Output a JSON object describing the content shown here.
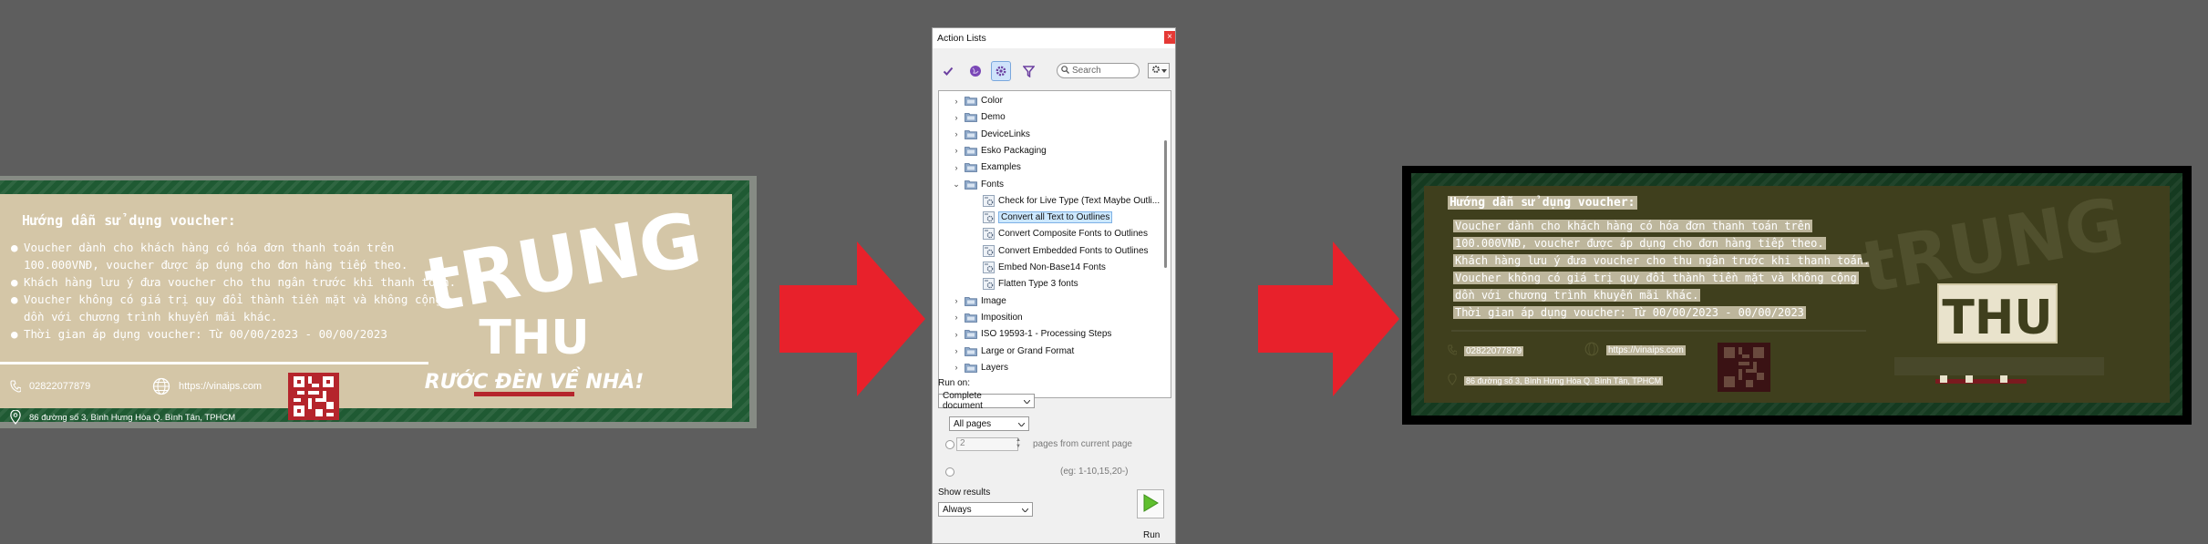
{
  "voucher": {
    "title": "Hướng dẫn sử dụng voucher:",
    "lines": [
      {
        "bullet": true,
        "text": "Voucher dành cho khách hàng có hóa đơn thanh toán trên"
      },
      {
        "bullet": false,
        "text": "100.000VNĐ, voucher được áp dụng cho đơn hàng tiếp theo."
      },
      {
        "bullet": true,
        "text": "Khách hàng lưu ý đưa voucher cho thu ngân trước khi thanh toán."
      },
      {
        "bullet": true,
        "text": "Voucher không có giá trị quy đổi thành tiền mặt và không cộng"
      },
      {
        "bullet": false,
        "text": "dồn với chương trình khuyến mãi khác."
      },
      {
        "bullet": true,
        "text": "Thời gian áp dụng voucher: Từ 00/00/2023 - 00/00/2023"
      }
    ],
    "phone": "02822077879",
    "website": "https://vinaips.com",
    "address": "86 đường số 3, Bình Hưng Hòa Q. Bình Tân, TPHCM",
    "headline_1": "tRUNG",
    "headline_2": "THU",
    "tagline": "RƯỚC ĐÈN VỀ NHÀ!"
  },
  "dark_voucher": {
    "title": "Hướng dẫn sử dụng voucher:",
    "lines": [
      "Voucher dành cho khách hàng có hóa đơn thanh toán trên",
      "100.000VNĐ, voucher được áp dụng cho đơn hàng tiếp theo.",
      "Khách hàng lưu ý đưa voucher cho thu ngân trước khi thanh toán.",
      "Voucher không có giá trị quy đổi thành tiền mặt và không cộng",
      "dồn với chương trình khuyến mãi khác.",
      "Thời gian áp dụng voucher: Từ 00/00/2023 - 00/00/2023"
    ],
    "phone": "02822077879",
    "website": "https://vinaips.com",
    "address": "86 đường số 3, Bình Hưng Hòa Q. Bình Tân, TPHCM",
    "headline_1": "tRUNG",
    "headline_2": "THU"
  },
  "colors": {
    "background": "#5e5e5e",
    "arrow": "#e8212b",
    "voucher_panel": "#d4c6a7",
    "voucher_frame": "#1f5a33",
    "qr_red": "#b5252c",
    "selection": "#cde8ff"
  },
  "action_panel": {
    "title": "Action Lists",
    "close_glyph": "×",
    "toolbar": {
      "icons": [
        "checkmark-icon",
        "globe-icon",
        "gear-icon",
        "filter-icon"
      ],
      "search_placeholder": "Search"
    },
    "tree": [
      {
        "label": "Color",
        "type": "folder",
        "expanded": false
      },
      {
        "label": "Demo",
        "type": "folder",
        "expanded": false
      },
      {
        "label": "DeviceLinks",
        "type": "folder",
        "expanded": false
      },
      {
        "label": "Esko Packaging",
        "type": "folder",
        "expanded": false
      },
      {
        "label": "Examples",
        "type": "folder",
        "expanded": false
      },
      {
        "label": "Fonts",
        "type": "folder",
        "expanded": true
      },
      {
        "label": "Check for Live Type (Text Maybe Outli...",
        "type": "action"
      },
      {
        "label": "Convert all Text to Outlines",
        "type": "action",
        "selected": true
      },
      {
        "label": "Convert Composite Fonts to Outlines",
        "type": "action"
      },
      {
        "label": "Convert Embedded Fonts to Outlines",
        "type": "action"
      },
      {
        "label": "Embed Non-Base14 Fonts",
        "type": "action"
      },
      {
        "label": "Flatten Type 3 fonts",
        "type": "action"
      },
      {
        "label": "Image",
        "type": "folder",
        "expanded": false
      },
      {
        "label": "Imposition",
        "type": "folder",
        "expanded": false
      },
      {
        "label": "ISO 19593-1 - Processing Steps",
        "type": "folder",
        "expanded": false
      },
      {
        "label": "Large or Grand Format",
        "type": "folder",
        "expanded": false
      },
      {
        "label": "Layers",
        "type": "folder",
        "expanded": false
      }
    ],
    "run_on_label": "Run on:",
    "run_on_value": "Complete document",
    "pages_value": "All pages",
    "pages_count_value": "2",
    "pages_from_current": "pages from current page",
    "range_hint": "(eg: 1-10,15,20-)",
    "show_results_label": "Show results",
    "show_results_value": "Always",
    "run_label": "Run"
  }
}
